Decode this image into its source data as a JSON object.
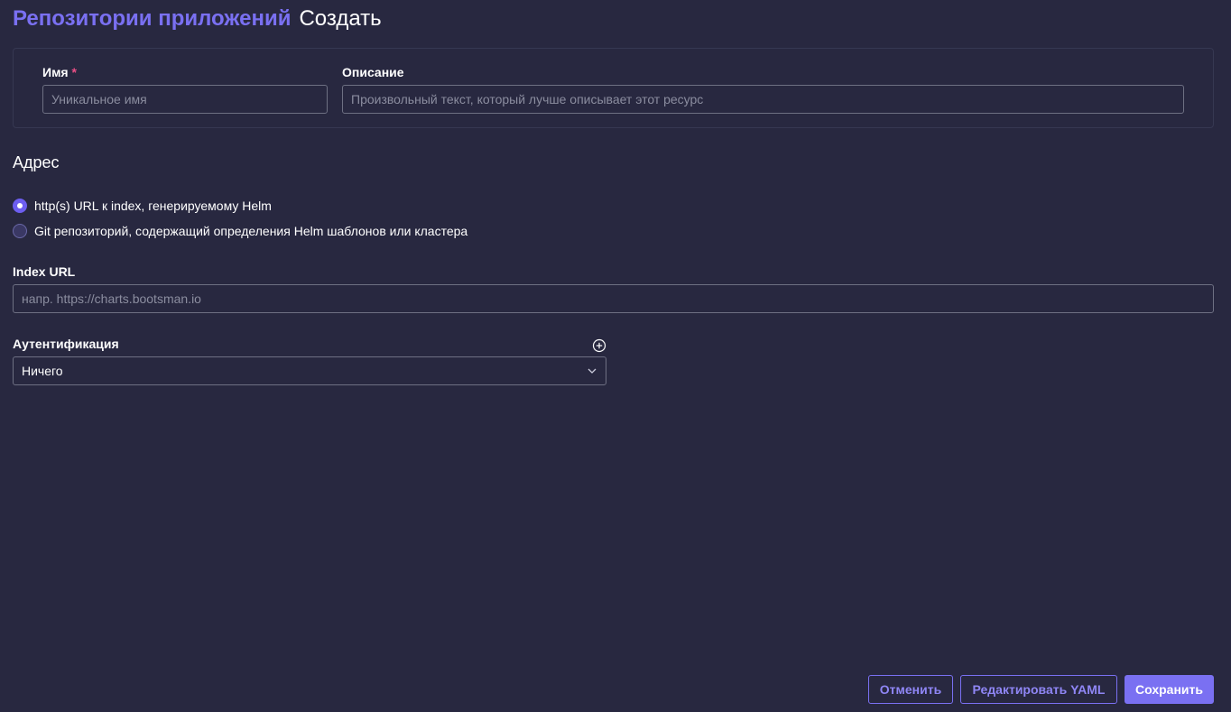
{
  "header": {
    "breadcrumb": "Репозитории приложений",
    "title": "Создать"
  },
  "form": {
    "name": {
      "label": "Имя",
      "required_mark": "*",
      "value": "",
      "placeholder": "Уникальное имя"
    },
    "description": {
      "label": "Описание",
      "value": "",
      "placeholder": "Произвольный текст, который лучше описывает этот ресурс"
    },
    "address": {
      "title": "Адрес",
      "options": [
        {
          "label": "http(s) URL к index, генерируемому Helm",
          "checked": true
        },
        {
          "label": "Git репозиторий, содержащий определения Helm шаблонов или кластера",
          "checked": false
        }
      ]
    },
    "index_url": {
      "label": "Index URL",
      "value": "",
      "placeholder": "напр. https://charts.bootsman.io"
    },
    "auth": {
      "label": "Аутентификация",
      "selected": "Ничего",
      "add_icon": "plus-circle-icon",
      "dropdown_icon": "chevron-down-icon"
    }
  },
  "footer": {
    "cancel_label": "Отменить",
    "edit_yaml_label": "Редактировать YAML",
    "save_label": "Сохранить"
  },
  "colors": {
    "background": "#282840",
    "accent": "#7a70f2",
    "required": "#ec4f86",
    "border": "#6e7083"
  }
}
